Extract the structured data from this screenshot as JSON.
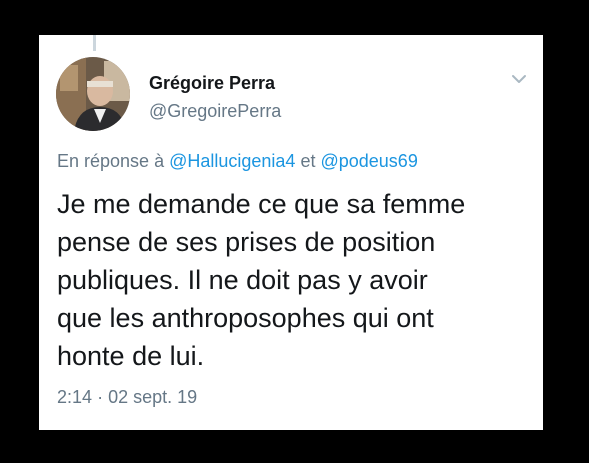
{
  "tweet": {
    "author": {
      "name": "Grégoire Perra",
      "handle": "@GregoirePerra"
    },
    "reply_prefix": "En réponse à",
    "reply_mentions": [
      "@Hallucigenia4",
      "@podeus69"
    ],
    "reply_conjunction": "et",
    "text_lines": [
      "Je me demande ce que sa femme",
      "pense de ses prises de position",
      "publiques. Il ne doit pas y avoir",
      "que les anthroposophes qui ont",
      "honte de lui."
    ],
    "time": "2:14",
    "separator": "·",
    "date": "02 sept. 19"
  },
  "colors": {
    "background": "#000000",
    "card": "#ffffff",
    "text": "#14171a",
    "secondary": "#657786",
    "link": "#1b95e0"
  },
  "icons": {
    "menu": "chevron-down-icon"
  }
}
